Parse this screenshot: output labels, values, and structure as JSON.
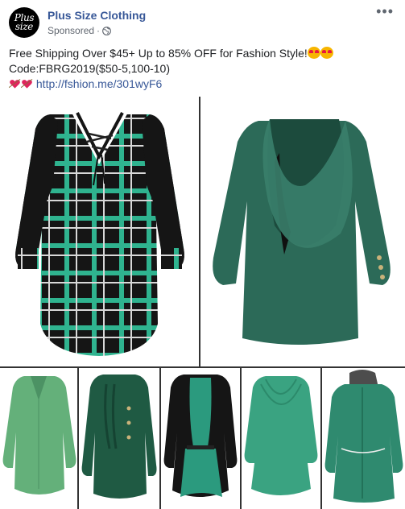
{
  "post": {
    "page_name": "Plus Size Clothing",
    "sponsored": "Sponsored",
    "sponsored_sep": "·",
    "avatar_logo_lines": [
      "Plus",
      "size"
    ],
    "more_label": "•••",
    "body_line1": "Free Shipping Over $45+ Up to 85% OFF for Fashion Style!",
    "body_line2": "Code:FBRG2019($50-5,100-10)",
    "link": "http://fshion.me/301wyF6"
  },
  "icons": {
    "globe": "globe-icon",
    "more": "more-options-icon",
    "emoji1": "heart-eyes-emoji",
    "emoji2": "heart-eyes-emoji",
    "heart1": "heart-arrow-emoji",
    "heart2": "heart-arrow-emoji"
  },
  "colors": {
    "brand_link": "#385898",
    "plaid_black": "#151515",
    "plaid_green": "#2fb38f",
    "dark_green": "#2c6a58",
    "sage_green": "#64b07a",
    "teal_green": "#3aa381",
    "forest_green": "#1f5a43"
  },
  "gallery": {
    "items": [
      {
        "name": "plaid-lace-up-top",
        "kind": "plaid"
      },
      {
        "name": "green-drape-top",
        "kind": "drape"
      },
      {
        "name": "sage-blouse",
        "kind": "blouse"
      },
      {
        "name": "cable-knit-cardigan",
        "kind": "cable"
      },
      {
        "name": "black-green-layered-top",
        "kind": "layer"
      },
      {
        "name": "green-cross-top",
        "kind": "cross"
      },
      {
        "name": "hooded-coat",
        "kind": "hood"
      }
    ]
  }
}
